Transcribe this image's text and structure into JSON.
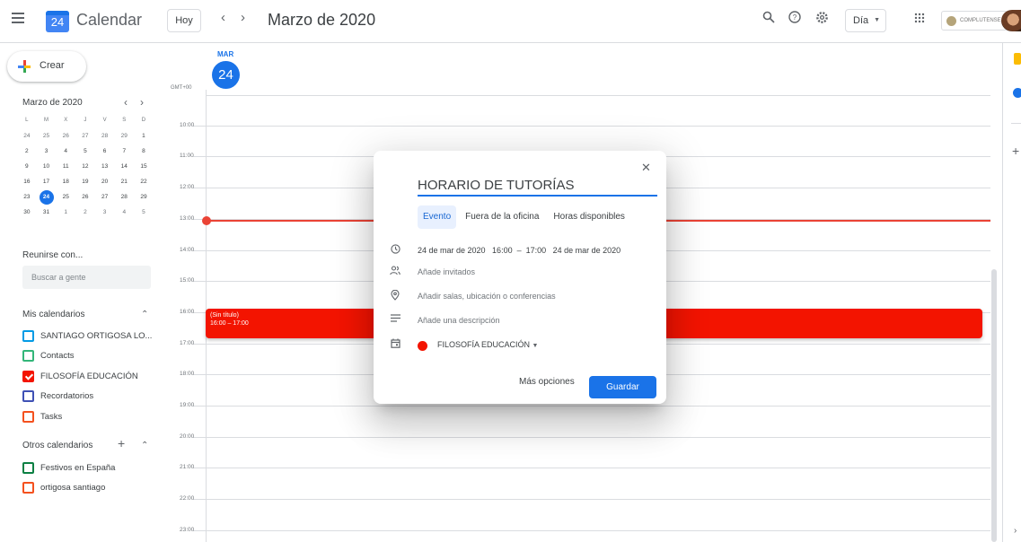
{
  "header": {
    "app_title": "Calendar",
    "logo_day": "24",
    "today_button": "Hoy",
    "month_title": "Marzo de 2020",
    "view_select": "Día",
    "org_badge": "COMPLUTENSE"
  },
  "sidebar": {
    "create_label": "Crear",
    "mini_cal": {
      "title": "Marzo de 2020",
      "weekday_headers": [
        "L",
        "M",
        "X",
        "J",
        "V",
        "S",
        "D"
      ],
      "weeks": [
        [
          "24",
          "25",
          "26",
          "27",
          "28",
          "29",
          "1"
        ],
        [
          "2",
          "3",
          "4",
          "5",
          "6",
          "7",
          "8"
        ],
        [
          "9",
          "10",
          "11",
          "12",
          "13",
          "14",
          "15"
        ],
        [
          "16",
          "17",
          "18",
          "19",
          "20",
          "21",
          "22"
        ],
        [
          "23",
          "24",
          "25",
          "26",
          "27",
          "28",
          "29"
        ],
        [
          "30",
          "31",
          "1",
          "2",
          "3",
          "4",
          "5"
        ]
      ],
      "selected_day": "24"
    },
    "meet_title": "Reunirse con...",
    "people_placeholder": "Buscar a gente",
    "my_calendars_title": "Mis calendarios",
    "my_calendars": [
      {
        "label": "SANTIAGO ORTIGOSA LO...",
        "color": "#039be5",
        "checked": false
      },
      {
        "label": "Contacts",
        "color": "#33b679",
        "checked": false
      },
      {
        "label": "FILOSOFÍA EDUCACIÓN",
        "color": "#f31400",
        "checked": true
      },
      {
        "label": "Recordatorios",
        "color": "#3f51b5",
        "checked": false
      },
      {
        "label": "Tasks",
        "color": "#f4511e",
        "checked": false
      }
    ],
    "other_calendars_title": "Otros calendarios",
    "other_calendars": [
      {
        "label": "Festivos en España",
        "color": "#0b8043",
        "checked": false
      },
      {
        "label": "ortigosa santiago",
        "color": "#f4511e",
        "checked": false
      }
    ]
  },
  "day_view": {
    "dow": "MAR",
    "day_number": "24",
    "timezone": "GMT+00",
    "hours": [
      "10:00",
      "11:00",
      "12:00",
      "13:00",
      "14:00",
      "15:00",
      "16:00",
      "17:00",
      "18:00",
      "19:00",
      "20:00",
      "21:00",
      "22:00",
      "23:00"
    ],
    "event": {
      "title": "(Sin título)",
      "time": "16:00 – 17:00"
    }
  },
  "modal": {
    "title_value": "HORARIO DE TUTORÍAS",
    "tabs": [
      "Evento",
      "Fuera de la oficina",
      "Horas disponibles"
    ],
    "datetime": "24 de mar de 2020   16:00  –  17:00   24 de mar de 2020",
    "guests": "Añade invitados",
    "location": "Añadir salas, ubicación o conferencias",
    "description": "Añade una descripción",
    "calendar": "FILOSOFÍA EDUCACIÓN",
    "more_options": "Más opciones",
    "save": "Guardar"
  },
  "colors": {
    "accent": "#1a73e8",
    "event": "#f31400",
    "now_line": "#ea4335"
  },
  "icons": [
    "menu-icon",
    "calendar-logo-icon",
    "chevron-left-icon",
    "chevron-right-icon",
    "search-icon",
    "help-icon",
    "settings-icon",
    "apps-icon",
    "close-icon",
    "clock-icon",
    "people-icon",
    "location-icon",
    "description-icon",
    "calendar-icon"
  ]
}
